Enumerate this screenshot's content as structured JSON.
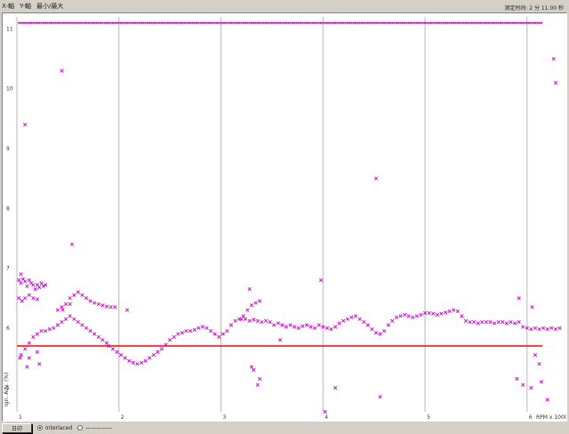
{
  "menu": {
    "items": [
      {
        "label": "X-軸"
      },
      {
        "label": "Y-軸"
      },
      {
        "label": "最小/最大"
      }
    ],
    "status": "测定时间: 2 分 11.00 秒"
  },
  "bottom": {
    "button_label": "日印",
    "radio_options": [
      {
        "label": "Interlaced",
        "selected": true
      },
      {
        "label": "—————",
        "selected": false
      }
    ]
  },
  "colors": {
    "scatter": "#cc00cc",
    "threshold": "#ff0000",
    "grid": "#b8b8b8"
  },
  "chart_data": {
    "type": "scatter",
    "x_ticks": [
      "1",
      "2",
      "3",
      "4",
      "5",
      "6"
    ],
    "y_ticks": [
      "11",
      "10",
      "9",
      "8",
      "7",
      "6",
      "5"
    ],
    "ylabel": "Ign. Adv. (%)",
    "xlabel": "RPM x 1000",
    "xlim": [
      1,
      6.35
    ],
    "ylim": [
      4.6,
      11.2
    ],
    "grid": true,
    "top_band_y": 11.1,
    "threshold_y": 5.7,
    "series_points": [
      [
        1.02,
        6.8
      ],
      [
        1.04,
        6.75
      ],
      [
        1.06,
        6.82
      ],
      [
        1.08,
        6.78
      ],
      [
        1.1,
        6.7
      ],
      [
        1.12,
        6.8
      ],
      [
        1.14,
        6.75
      ],
      [
        1.16,
        6.72
      ],
      [
        1.18,
        6.65
      ],
      [
        1.2,
        6.72
      ],
      [
        1.22,
        6.68
      ],
      [
        1.24,
        6.75
      ],
      [
        1.26,
        6.7
      ],
      [
        1.28,
        6.72
      ],
      [
        1.02,
        6.5
      ],
      [
        1.05,
        6.45
      ],
      [
        1.08,
        6.5
      ],
      [
        1.12,
        6.55
      ],
      [
        1.16,
        6.5
      ],
      [
        1.2,
        6.48
      ],
      [
        1.04,
        5.55
      ],
      [
        1.08,
        5.65
      ],
      [
        1.12,
        5.75
      ],
      [
        1.16,
        5.85
      ],
      [
        1.2,
        5.9
      ],
      [
        1.24,
        5.95
      ],
      [
        1.28,
        5.95
      ],
      [
        1.32,
        5.98
      ],
      [
        1.36,
        6.0
      ],
      [
        1.4,
        6.05
      ],
      [
        1.44,
        6.1
      ],
      [
        1.48,
        6.15
      ],
      [
        1.52,
        6.2
      ],
      [
        1.56,
        6.15
      ],
      [
        1.6,
        6.1
      ],
      [
        1.64,
        6.05
      ],
      [
        1.68,
        6.0
      ],
      [
        1.72,
        5.95
      ],
      [
        1.76,
        5.9
      ],
      [
        1.8,
        5.85
      ],
      [
        1.84,
        5.8
      ],
      [
        1.88,
        5.75
      ],
      [
        1.4,
        6.3
      ],
      [
        1.44,
        6.35
      ],
      [
        1.48,
        6.4
      ],
      [
        1.52,
        6.5
      ],
      [
        1.56,
        6.55
      ],
      [
        1.6,
        6.6
      ],
      [
        1.64,
        6.55
      ],
      [
        1.68,
        6.5
      ],
      [
        1.72,
        6.45
      ],
      [
        1.76,
        6.42
      ],
      [
        1.8,
        6.4
      ],
      [
        1.84,
        6.38
      ],
      [
        1.88,
        6.36
      ],
      [
        1.92,
        6.35
      ],
      [
        1.96,
        6.35
      ],
      [
        1.9,
        5.7
      ],
      [
        1.94,
        5.65
      ],
      [
        1.98,
        5.6
      ],
      [
        2.02,
        5.55
      ],
      [
        2.06,
        5.5
      ],
      [
        2.1,
        5.45
      ],
      [
        2.14,
        5.42
      ],
      [
        2.18,
        5.4
      ],
      [
        2.22,
        5.42
      ],
      [
        2.26,
        5.45
      ],
      [
        2.3,
        5.5
      ],
      [
        2.34,
        5.55
      ],
      [
        2.38,
        5.6
      ],
      [
        2.42,
        5.65
      ],
      [
        2.46,
        5.72
      ],
      [
        2.5,
        5.8
      ],
      [
        2.54,
        5.85
      ],
      [
        2.58,
        5.9
      ],
      [
        2.62,
        5.92
      ],
      [
        2.66,
        5.95
      ],
      [
        2.7,
        5.95
      ],
      [
        2.74,
        5.97
      ],
      [
        2.78,
        6.0
      ],
      [
        2.82,
        6.02
      ],
      [
        2.86,
        6.0
      ],
      [
        2.9,
        5.95
      ],
      [
        2.94,
        5.9
      ],
      [
        2.98,
        5.85
      ],
      [
        3.02,
        5.9
      ],
      [
        3.06,
        5.95
      ],
      [
        3.1,
        6.05
      ],
      [
        3.14,
        6.12
      ],
      [
        3.18,
        6.15
      ],
      [
        3.22,
        6.2
      ],
      [
        3.26,
        6.3
      ],
      [
        3.3,
        6.38
      ],
      [
        3.34,
        6.42
      ],
      [
        3.38,
        6.45
      ],
      [
        3.2,
        6.15
      ],
      [
        3.24,
        6.15
      ],
      [
        3.28,
        6.12
      ],
      [
        3.32,
        6.14
      ],
      [
        3.36,
        6.12
      ],
      [
        3.4,
        6.1
      ],
      [
        3.44,
        6.12
      ],
      [
        3.48,
        6.1
      ],
      [
        3.52,
        6.05
      ],
      [
        3.56,
        6.08
      ],
      [
        3.6,
        6.05
      ],
      [
        3.64,
        6.02
      ],
      [
        3.68,
        6.05
      ],
      [
        3.72,
        6.02
      ],
      [
        3.76,
        6.0
      ],
      [
        3.8,
        6.03
      ],
      [
        3.84,
        6.05
      ],
      [
        3.88,
        6.02
      ],
      [
        3.92,
        6.0
      ],
      [
        3.96,
        6.05
      ],
      [
        4.0,
        6.02
      ],
      [
        4.04,
        6.0
      ],
      [
        4.08,
        5.98
      ],
      [
        4.12,
        6.02
      ],
      [
        4.16,
        6.08
      ],
      [
        4.2,
        6.12
      ],
      [
        4.24,
        6.15
      ],
      [
        4.28,
        6.18
      ],
      [
        4.32,
        6.2
      ],
      [
        4.36,
        6.15
      ],
      [
        4.4,
        6.1
      ],
      [
        4.44,
        6.05
      ],
      [
        4.48,
        5.98
      ],
      [
        4.52,
        5.92
      ],
      [
        4.56,
        5.9
      ],
      [
        4.6,
        5.95
      ],
      [
        4.64,
        6.05
      ],
      [
        4.68,
        6.12
      ],
      [
        4.72,
        6.18
      ],
      [
        4.76,
        6.2
      ],
      [
        4.8,
        6.22
      ],
      [
        4.84,
        6.2
      ],
      [
        4.88,
        6.18
      ],
      [
        4.92,
        6.2
      ],
      [
        4.96,
        6.22
      ],
      [
        5.0,
        6.25
      ],
      [
        5.04,
        6.25
      ],
      [
        5.08,
        6.24
      ],
      [
        5.12,
        6.22
      ],
      [
        5.16,
        6.24
      ],
      [
        5.2,
        6.26
      ],
      [
        5.24,
        6.28
      ],
      [
        5.28,
        6.3
      ],
      [
        5.32,
        6.28
      ],
      [
        5.36,
        6.2
      ],
      [
        5.4,
        6.12
      ],
      [
        5.44,
        6.1
      ],
      [
        5.48,
        6.1
      ],
      [
        5.52,
        6.08
      ],
      [
        5.56,
        6.1
      ],
      [
        5.6,
        6.1
      ],
      [
        5.64,
        6.1
      ],
      [
        5.68,
        6.08
      ],
      [
        5.72,
        6.1
      ],
      [
        5.76,
        6.1
      ],
      [
        5.8,
        6.08
      ],
      [
        5.84,
        6.1
      ],
      [
        5.88,
        6.08
      ],
      [
        5.92,
        6.1
      ],
      [
        5.96,
        6.02
      ],
      [
        6.0,
        6.0
      ],
      [
        6.04,
        5.98
      ],
      [
        6.08,
        6.0
      ],
      [
        6.12,
        5.98
      ],
      [
        6.16,
        6.0
      ],
      [
        6.2,
        5.98
      ],
      [
        6.24,
        6.0
      ],
      [
        6.28,
        5.98
      ],
      [
        6.32,
        6.0
      ]
    ],
    "outlier_points": [
      [
        1.44,
        10.3
      ],
      [
        1.08,
        9.4
      ],
      [
        1.54,
        7.4
      ],
      [
        1.04,
        6.9
      ],
      [
        1.52,
        6.4
      ],
      [
        1.45,
        6.3
      ],
      [
        1.03,
        5.5
      ],
      [
        1.12,
        5.5
      ],
      [
        1.2,
        5.6
      ],
      [
        1.1,
        5.35
      ],
      [
        1.22,
        5.4
      ],
      [
        2.08,
        6.3
      ],
      [
        3.28,
        6.65
      ],
      [
        3.3,
        5.35
      ],
      [
        3.32,
        5.3
      ],
      [
        3.38,
        5.15
      ],
      [
        3.36,
        5.05
      ],
      [
        3.58,
        5.8
      ],
      [
        3.98,
        6.8
      ],
      [
        4.02,
        4.6
      ],
      [
        4.12,
        5.0
      ],
      [
        4.52,
        8.5
      ],
      [
        4.56,
        4.85
      ],
      [
        5.92,
        6.5
      ],
      [
        6.05,
        6.35
      ],
      [
        5.9,
        5.15
      ],
      [
        5.96,
        5.05
      ],
      [
        6.04,
        5.0
      ],
      [
        6.08,
        5.55
      ],
      [
        6.12,
        5.4
      ],
      [
        6.14,
        5.1
      ],
      [
        6.2,
        4.8
      ],
      [
        6.26,
        10.5
      ],
      [
        6.28,
        10.1
      ]
    ]
  }
}
